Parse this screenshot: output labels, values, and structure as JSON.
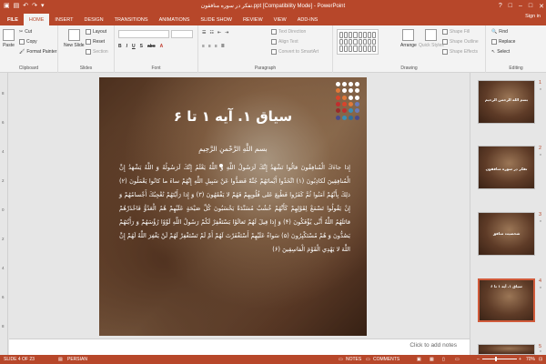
{
  "window": {
    "title": "تفکر در سوره منافقون.ppt [Compatibility Mode] - PowerPoint",
    "controls": [
      "?",
      "□",
      "–",
      "□",
      "✕"
    ]
  },
  "tabs": [
    {
      "label": "FILE"
    },
    {
      "label": "HOME"
    },
    {
      "label": "INSERT"
    },
    {
      "label": "DESIGN"
    },
    {
      "label": "TRANSITIONS"
    },
    {
      "label": "ANIMATIONS"
    },
    {
      "label": "SLIDE SHOW"
    },
    {
      "label": "REVIEW"
    },
    {
      "label": "VIEW"
    },
    {
      "label": "ADD-INS"
    }
  ],
  "account": {
    "sign_in": "Sign in"
  },
  "ribbon": {
    "clipboard": {
      "paste": "Paste",
      "cut": "Cut",
      "copy": "Copy",
      "format_painter": "Format Painter",
      "label": "Clipboard"
    },
    "slides": {
      "new_slide": "New Slide",
      "layout": "Layout",
      "reset": "Reset",
      "section": "Section",
      "label": "Slides"
    },
    "font": {
      "label": "Font"
    },
    "paragraph": {
      "text_direction": "Text Direction",
      "align_text": "Align Text",
      "convert_smartart": "Convert to SmartArt",
      "label": "Paragraph"
    },
    "drawing": {
      "arrange": "Arrange",
      "quick_styles": "Quick Styles",
      "shape_fill": "Shape Fill",
      "shape_outline": "Shape Outline",
      "shape_effects": "Shape Effects",
      "label": "Drawing"
    },
    "editing": {
      "find": "Find",
      "replace": "Replace",
      "select": "Select",
      "label": "Editing"
    }
  },
  "ruler": {
    "marks": [
      "8",
      "6",
      "4",
      "2",
      "0",
      "2",
      "4",
      "6",
      "8"
    ]
  },
  "slide": {
    "title": "سیاق ۱. آیه ۱ تا ۶",
    "basmala": "بسم اللَّهِ الرَّحْمنِ الرَّحِيمِ",
    "body": "إِذا جاءَكَ الْمُنافِقُونَ قالُوا نَشْهَدُ إِنَّكَ لَرَسُولُ اللَّهِ وَ اللَّهُ يَعْلَمُ إِنَّكَ لَرَسُولُهُ وَ اللَّهُ يَشْهَدُ إِنَّ الْمُنافِقِينَ لَكاذِبُونَ (۱) اتَّخَذُوا أَيْمانَهُمْ جُنَّةً فَصَدُّوا عَنْ سَبِيلِ اللَّهِ إِنَّهُمْ ساءَ ما كانُوا يَعْمَلُونَ (۲) ذلِكَ بِأَنَّهُمْ آمَنُوا ثُمَّ كَفَرُوا فَطُبِعَ عَلى قُلُوبِهِمْ فَهُمْ لا يَفْقَهُونَ (۳) وَ إِذا رَأَيْتَهُمْ تُعْجِبُكَ أَجْسامُهُمْ وَ إِنْ يَقُولُوا تَسْمَعْ لِقَوْلِهِمْ كَأَنَّهُمْ خُشُبٌ مُسَنَّدَةٌ يَحْسَبُونَ كُلَّ صَيْحَةٍ عَلَيْهِمْ هُمُ الْعَدُوُّ فَاحْذَرْهُمْ قاتَلَهُمُ اللَّهُ أَنَّى يُؤْفَكُونَ (۴) وَ إِذا قِيلَ لَهُمْ تَعالَوْا يَسْتَغْفِرْ لَكُمْ رَسُولُ اللَّهِ لَوَّوْا رُؤُسَهُمْ وَ رَأَيْتَهُمْ يَصُدُّونَ وَ هُمْ مُسْتَكْبِرُونَ (۵) سَواءٌ عَلَيْهِمْ أَسْتَغْفَرْتَ لَهُمْ أَمْ لَمْ تَسْتَغْفِرْ لَهُمْ لَنْ يَغْفِرَ اللَّهُ لَهُمْ إِنَّ اللَّهَ لا يَهْدِي الْقَوْمَ الْفاسِقِينَ (۶)",
    "dot_colors": [
      "#ffffff",
      "#ffffff",
      "#ffffff",
      "#ffffff",
      "#e07a3a",
      "#ffffff",
      "#ffffff",
      "#ffffff",
      "#d9442b",
      "#e07a3a",
      "#ffffff",
      "#ffffff",
      "#c02e2e",
      "#d9442b",
      "#e07a3a",
      "#6a7bb8",
      "#9a2a2a",
      "#c02e2e",
      "#3a8fb5",
      "#6a7bb8",
      "#4a4a8a",
      "#3a8fb5",
      "#2f6f9a",
      "#4a4a8a"
    ]
  },
  "thumbnails": [
    {
      "num": "1",
      "star": "*",
      "text": "بسم الله الرحمن الرحیم"
    },
    {
      "num": "2",
      "star": "*",
      "text": "تفکر در سوره منافقون"
    },
    {
      "num": "3",
      "star": "*",
      "text": "شخصیت منافق"
    },
    {
      "num": "4",
      "star": "*",
      "text": "سیاق ۱. آیه ۱ تا ۶"
    },
    {
      "num": "5",
      "star": "*",
      "text": ""
    }
  ],
  "notes": {
    "placeholder": "Click to add notes"
  },
  "status": {
    "slide_of": "SLIDE 4 OF 23",
    "language": "PERSIAN",
    "notes": "NOTES",
    "comments": "COMMENTS",
    "zoom": "70%"
  }
}
